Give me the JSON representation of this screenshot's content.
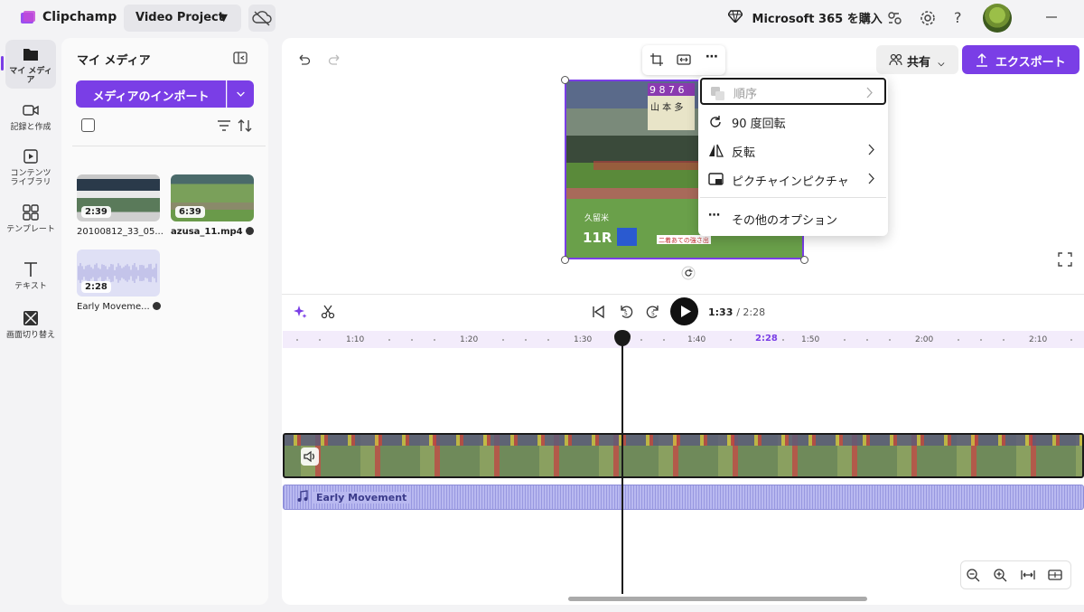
{
  "app": {
    "name": "Clipchamp",
    "project_name": "Video Project"
  },
  "topbar": {
    "ms365_label": "Microsoft 365 を購入"
  },
  "rail": [
    {
      "label": "マイ メディア"
    },
    {
      "label": "記録と作成"
    },
    {
      "label": "コンテンツ ライブラリ"
    },
    {
      "label": "テンプレート"
    },
    {
      "label": "テキスト"
    },
    {
      "label": "画面切り替え"
    }
  ],
  "media_panel": {
    "title": "マイ メディア",
    "import_label": "メディアのインポート",
    "items": [
      {
        "name": "20100812_33_05...",
        "duration": "2:39",
        "checked": false
      },
      {
        "name": "azusa_11.mp4",
        "duration": "6:39",
        "checked": true
      },
      {
        "name": "Early Moveme...",
        "duration": "2:28",
        "checked": true
      }
    ]
  },
  "header": {
    "share_label": "共有",
    "export_label": "エクスポート"
  },
  "preview": {
    "overlay_numbers": "9 8 7 6",
    "overlay_race": "11R",
    "overlay_venue": "久留米",
    "overlay_names": "山 本 多",
    "overlay_caption": "二着あての強さ出"
  },
  "context_menu": {
    "items": [
      {
        "label": "順序",
        "disabled": true,
        "submenu": true
      },
      {
        "label": "90 度回転",
        "disabled": false,
        "submenu": false
      },
      {
        "label": "反転",
        "disabled": false,
        "submenu": true
      },
      {
        "label": "ピクチャインピクチャ",
        "disabled": false,
        "submenu": true
      },
      {
        "label": "その他のオプション",
        "disabled": false,
        "submenu": false
      }
    ]
  },
  "playback": {
    "current": "1:33",
    "total": "/ 2:28"
  },
  "ruler": {
    "ticks": [
      "1:10",
      "1:20",
      "1:30",
      "1:40",
      "1:50",
      "2:00",
      "2:10"
    ],
    "end_marker": "2:28"
  },
  "tracks": {
    "audio_label": "Early Movement"
  },
  "colors": {
    "accent": "#7a3ee6",
    "audio_track": "#b9b9f0"
  }
}
